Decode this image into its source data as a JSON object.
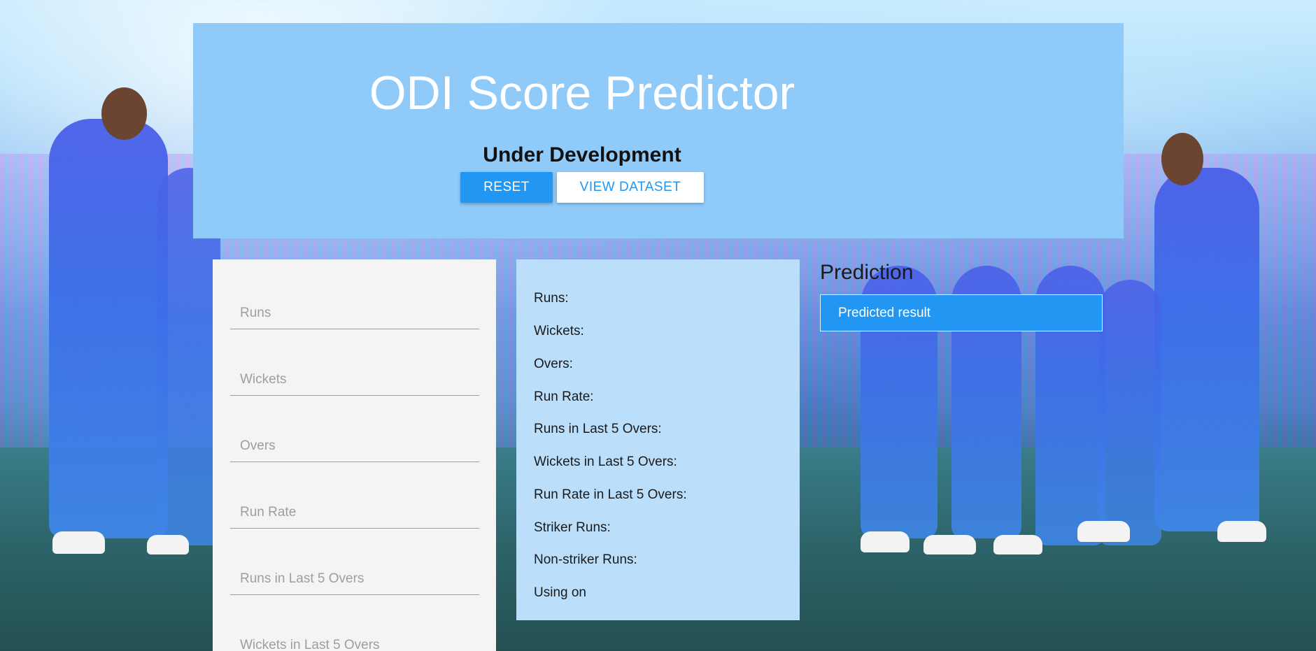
{
  "header": {
    "title": "ODI Score Predictor",
    "subtitle": "Under Development",
    "reset_label": "RESET",
    "view_dataset_label": "VIEW DATASET"
  },
  "inputs": {
    "runs": "Runs",
    "wickets": "Wickets",
    "overs": "Overs",
    "run_rate": "Run Rate",
    "runs_last5": "Runs in Last 5 Overs",
    "wickets_last5": "Wickets in Last 5 Overs"
  },
  "summary": {
    "runs": "Runs:",
    "wickets": "Wickets:",
    "overs": "Overs:",
    "run_rate": "Run Rate:",
    "runs_last5": "Runs in Last 5 Overs:",
    "wickets_last5": "Wickets in Last 5 Overs:",
    "run_rate_last5": "Run Rate in Last 5 Overs:",
    "striker_runs": "Striker Runs:",
    "non_striker_runs": "Non-striker Runs:",
    "using_on": "Using on"
  },
  "prediction": {
    "title": "Prediction",
    "result": "Predicted result"
  },
  "colors": {
    "header_bg": "#90caf9",
    "accent": "#2196f3",
    "values_bg": "#bbdefb",
    "inputs_bg": "#f4f4f4"
  }
}
